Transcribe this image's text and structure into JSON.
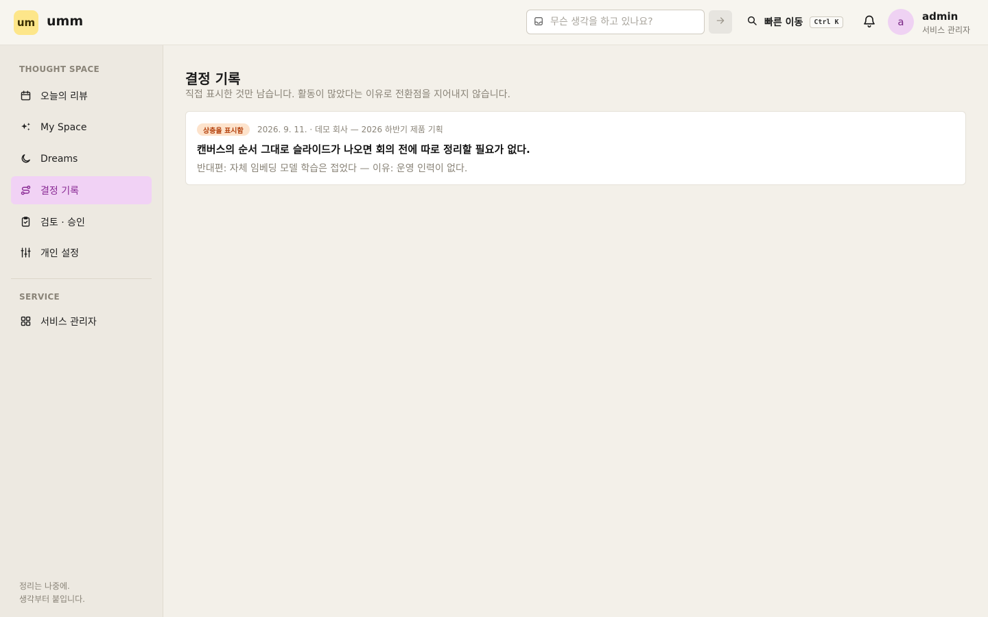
{
  "app": {
    "logo_badge": "um",
    "name": "umm"
  },
  "header": {
    "capture_placeholder": "무슨 생각을 하고 있나요?",
    "quick_jump_label": "빠른 이동",
    "quick_jump_shortcut": "Ctrl K",
    "user": {
      "avatar_letter": "a",
      "name": "admin",
      "role": "서비스 관리자"
    }
  },
  "sidebar": {
    "section_thought": "THOUGHT SPACE",
    "items": [
      {
        "label": "오늘의 리뷰",
        "icon": "calendar-icon"
      },
      {
        "label": "My Space",
        "icon": "sparkles-icon"
      },
      {
        "label": "Dreams",
        "icon": "moon-icon"
      },
      {
        "label": "결정 기록",
        "icon": "route-icon",
        "active": true
      },
      {
        "label": "검토 · 승인",
        "icon": "clipboard-check-icon"
      },
      {
        "label": "개인 설정",
        "icon": "sliders-icon"
      }
    ],
    "section_service": "SERVICE",
    "service_items": [
      {
        "label": "서비스 관리자",
        "icon": "grid-icon"
      }
    ],
    "footer_line1": "정리는 나중에.",
    "footer_line2": "생각부터 붙입니다."
  },
  "main": {
    "title": "결정 기록",
    "subtitle": "직접 표시한 것만 남습니다. 활동이 많았다는 이유로 전환점을 지어내지 않습니다.",
    "decisions": [
      {
        "badge": "상충을 표시함",
        "meta": "2026. 9. 11. · 데모 회사 — 2026 하반기 제품 기획",
        "text": "캔버스의 순서 그대로 슬라이드가 나오면 회의 전에 따로 정리할 필요가 없다.",
        "counter": "반대편: 자체 임베딩 모델 학습은 접었다 — 이유: 운영 인력이 없다."
      }
    ]
  },
  "colors": {
    "accent": "#8a2c95",
    "active_bg": "#f1d2f5",
    "logo": "#fde68a",
    "badge_bg": "#fde3cc",
    "badge_text": "#b4410d"
  }
}
